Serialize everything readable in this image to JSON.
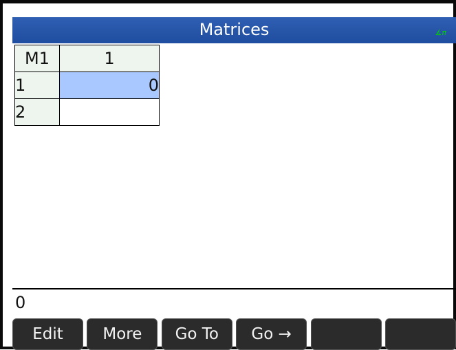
{
  "header": {
    "title": "Matrices",
    "status_indicator": "∡π"
  },
  "matrix": {
    "name": "M1",
    "column_headers": [
      "1"
    ],
    "rows": [
      {
        "label": "1",
        "cells": [
          "0"
        ]
      },
      {
        "label": "2",
        "cells": [
          ""
        ]
      }
    ]
  },
  "entry_line": {
    "value": "0"
  },
  "softkeys": [
    "Edit",
    "More",
    "Go To",
    "Go →",
    "",
    ""
  ]
}
